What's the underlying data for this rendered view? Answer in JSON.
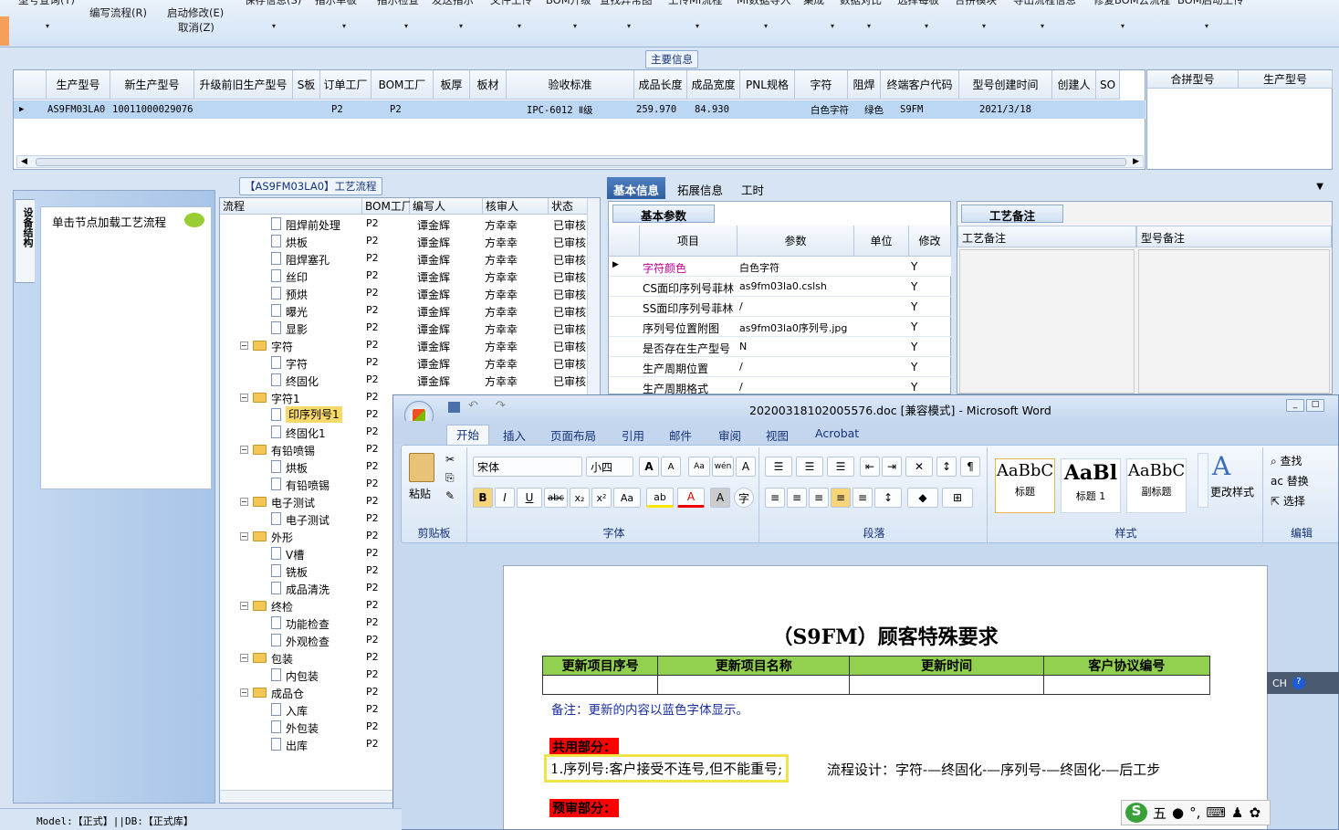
{
  "toolbar": {
    "row1": [
      "型号查询(Y)",
      "保存信息(S)",
      "指示单板",
      "指示检查",
      "发送指示",
      "文件上传",
      "BOM升级",
      "查找异常图",
      "上传MI流程",
      "MI数据导入",
      "集成",
      "数据对比",
      "选择每板",
      "合拼模块",
      "导出流程信息",
      "修复BOM去流程",
      "BOM启动上传"
    ],
    "write_flow": "编写流程(R)",
    "start_edit": "启动修改(E)",
    "cancel_edit": "取消(Z)"
  },
  "main_info": {
    "title": "主要信息",
    "columns": [
      "生产型号",
      "新生产型号",
      "升级前旧生产型号",
      "S板",
      "订单工厂",
      "BOM工厂",
      "板厚",
      "板材",
      "验收标准",
      "成品长度",
      "成品宽度",
      "PNL规格",
      "字符",
      "阻焊",
      "终端客户代码",
      "型号创建时间",
      "创建人",
      "SO"
    ],
    "row": {
      "model": "AS9FM03LA0",
      "new_model": "10011000029076",
      "order_factory": "P2",
      "bom_factory": "P2",
      "standard": "IPC-6012 Ⅱ级",
      "length": "259.970",
      "width": "84.930",
      "char": "白色字符",
      "mask": "绿色",
      "customer": "S9FM",
      "created": "2021/3/18"
    }
  },
  "merge": {
    "columns": [
      "合拼型号",
      "生产型号"
    ]
  },
  "left_panel": {
    "vtab": "设备结构",
    "hint": "单击节点加载工艺流程"
  },
  "flow_panel": {
    "title": "【AS9FM03LA0】工艺流程",
    "columns": [
      "流程",
      "BOM工厂",
      "编写人",
      "核审人",
      "状态"
    ],
    "rows": [
      {
        "label": "阻焊前处理",
        "level": 2,
        "kind": "doc",
        "factory": "P2",
        "writer": "谭金辉",
        "reviewer": "方幸幸",
        "status": "已审核"
      },
      {
        "label": "烘板",
        "level": 2,
        "kind": "doc",
        "factory": "P2",
        "writer": "谭金辉",
        "reviewer": "方幸幸",
        "status": "已审核"
      },
      {
        "label": "阻焊塞孔",
        "level": 2,
        "kind": "doc",
        "factory": "P2",
        "writer": "谭金辉",
        "reviewer": "方幸幸",
        "status": "已审核"
      },
      {
        "label": "丝印",
        "level": 2,
        "kind": "doc",
        "factory": "P2",
        "writer": "谭金辉",
        "reviewer": "方幸幸",
        "status": "已审核"
      },
      {
        "label": "预烘",
        "level": 2,
        "kind": "doc",
        "factory": "P2",
        "writer": "谭金辉",
        "reviewer": "方幸幸",
        "status": "已审核"
      },
      {
        "label": "曝光",
        "level": 2,
        "kind": "doc",
        "factory": "P2",
        "writer": "谭金辉",
        "reviewer": "方幸幸",
        "status": "已审核"
      },
      {
        "label": "显影",
        "level": 2,
        "kind": "doc",
        "factory": "P2",
        "writer": "谭金辉",
        "reviewer": "方幸幸",
        "status": "已审核"
      },
      {
        "label": "字符",
        "level": 1,
        "kind": "folder",
        "factory": "P2",
        "writer": "谭金辉",
        "reviewer": "方幸幸",
        "status": "已审核"
      },
      {
        "label": "字符",
        "level": 2,
        "kind": "doc",
        "factory": "P2",
        "writer": "谭金辉",
        "reviewer": "方幸幸",
        "status": "已审核"
      },
      {
        "label": "终固化",
        "level": 2,
        "kind": "doc",
        "factory": "P2",
        "writer": "谭金辉",
        "reviewer": "方幸幸",
        "status": "已审核"
      },
      {
        "label": "字符1",
        "level": 1,
        "kind": "folder",
        "factory": "P2",
        "writer": "",
        "reviewer": "",
        "status": ""
      },
      {
        "label": "印序列号1",
        "level": 2,
        "kind": "doc",
        "factory": "P2",
        "writer": "",
        "reviewer": "",
        "status": "",
        "selected": true
      },
      {
        "label": "终固化1",
        "level": 2,
        "kind": "doc",
        "factory": "P2",
        "writer": "",
        "reviewer": "",
        "status": ""
      },
      {
        "label": "有铅喷锡",
        "level": 1,
        "kind": "folder",
        "factory": "P2",
        "writer": "",
        "reviewer": "",
        "status": ""
      },
      {
        "label": "烘板",
        "level": 2,
        "kind": "doc",
        "factory": "P2",
        "writer": "",
        "reviewer": "",
        "status": ""
      },
      {
        "label": "有铅喷锡",
        "level": 2,
        "kind": "doc",
        "factory": "P2",
        "writer": "",
        "reviewer": "",
        "status": ""
      },
      {
        "label": "电子测试",
        "level": 1,
        "kind": "folder",
        "factory": "P2",
        "writer": "",
        "reviewer": "",
        "status": ""
      },
      {
        "label": "电子测试",
        "level": 2,
        "kind": "doc",
        "factory": "P2",
        "writer": "",
        "reviewer": "",
        "status": ""
      },
      {
        "label": "外形",
        "level": 1,
        "kind": "folder",
        "factory": "P2",
        "writer": "",
        "reviewer": "",
        "status": ""
      },
      {
        "label": "V槽",
        "level": 2,
        "kind": "doc",
        "factory": "P2",
        "writer": "",
        "reviewer": "",
        "status": ""
      },
      {
        "label": "铣板",
        "level": 2,
        "kind": "doc",
        "factory": "P2",
        "writer": "",
        "reviewer": "",
        "status": ""
      },
      {
        "label": "成品清洗",
        "level": 2,
        "kind": "doc",
        "factory": "P2",
        "writer": "",
        "reviewer": "",
        "status": ""
      },
      {
        "label": "终检",
        "level": 1,
        "kind": "folder",
        "factory": "P2",
        "writer": "",
        "reviewer": "",
        "status": ""
      },
      {
        "label": "功能检查",
        "level": 2,
        "kind": "doc",
        "factory": "P2",
        "writer": "",
        "reviewer": "",
        "status": ""
      },
      {
        "label": "外观检查",
        "level": 2,
        "kind": "doc",
        "factory": "P2",
        "writer": "",
        "reviewer": "",
        "status": ""
      },
      {
        "label": "包装",
        "level": 1,
        "kind": "folder",
        "factory": "P2",
        "writer": "",
        "reviewer": "",
        "status": ""
      },
      {
        "label": "内包装",
        "level": 2,
        "kind": "doc",
        "factory": "P2",
        "writer": "",
        "reviewer": "",
        "status": ""
      },
      {
        "label": "成品仓",
        "level": 1,
        "kind": "folder",
        "factory": "P2",
        "writer": "",
        "reviewer": "",
        "status": ""
      },
      {
        "label": "入库",
        "level": 2,
        "kind": "doc",
        "factory": "P2",
        "writer": "",
        "reviewer": "",
        "status": ""
      },
      {
        "label": "外包装",
        "level": 2,
        "kind": "doc",
        "factory": "P2",
        "writer": "",
        "reviewer": "",
        "status": ""
      },
      {
        "label": "出库",
        "level": 2,
        "kind": "doc",
        "factory": "P2",
        "writer": "",
        "reviewer": "",
        "status": ""
      }
    ]
  },
  "right_tabs": [
    "基本信息",
    "拓展信息",
    "工时"
  ],
  "basic": {
    "title": "基本参数",
    "columns": [
      "项目",
      "参数",
      "单位",
      "修改"
    ],
    "rows": [
      {
        "item": "字符颜色",
        "param": "白色字符",
        "unit": "",
        "mod": "Y",
        "highlight": true
      },
      {
        "item": "CS面印序列号菲林",
        "param": "as9fm03la0.cslsh",
        "unit": "",
        "mod": "Y"
      },
      {
        "item": "SS面印序列号菲林",
        "param": "/",
        "unit": "",
        "mod": "Y"
      },
      {
        "item": "序列号位置附图",
        "param": "as9fm03la0序列号.jpg",
        "unit": "",
        "mod": "Y"
      },
      {
        "item": "是否存在生产型号",
        "param": "N",
        "unit": "",
        "mod": "Y"
      },
      {
        "item": "生产周期位置",
        "param": "/",
        "unit": "",
        "mod": "Y"
      },
      {
        "item": "生产周期格式",
        "param": "/",
        "unit": "",
        "mod": "Y"
      }
    ]
  },
  "remarks": {
    "title": "工艺备注",
    "col1": "工艺备注",
    "col2": "型号备注"
  },
  "word": {
    "title": "20200318102005576.doc [兼容模式] - Microsoft Word",
    "tabs": [
      "开始",
      "插入",
      "页面布局",
      "引用",
      "邮件",
      "审阅",
      "视图",
      "Acrobat"
    ],
    "paste": "粘贴",
    "font_name": "宋体",
    "font_size": "小四",
    "groups": [
      "剪贴板",
      "字体",
      "段落",
      "样式",
      "编辑"
    ],
    "styles": [
      {
        "preview": "AaBbC",
        "label": "标题"
      },
      {
        "preview": "AaBl",
        "label": "标题 1"
      },
      {
        "preview": "AaBbC",
        "label": "副标题"
      }
    ],
    "change_style": "更改样式",
    "find": "查找",
    "replace": "替换",
    "select": "选择",
    "doc_title": "（S9FM）顾客特殊要求",
    "table_headers": [
      "更新项目序号",
      "更新项目名称",
      "更新时间",
      "客户协议编号"
    ],
    "note": "备注：更新的内容以蓝色字体显示。",
    "section1": "共用部分：",
    "item1": "1.序列号:客户接受不连号,但不能重号;",
    "item1_rest": "流程设计：字符-—终固化-—序列号-—终固化-—后工步",
    "section2": "预审部分："
  },
  "status": "Model:【正式】||DB:【正式库】",
  "ime": {
    "mode": "五"
  },
  "langbar": {
    "lang": "CH"
  }
}
